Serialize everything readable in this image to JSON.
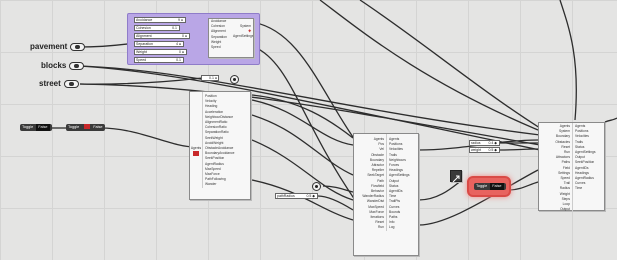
{
  "params": {
    "pavement": "pavement",
    "blocks": "blocks",
    "street": "street"
  },
  "purple_group": {
    "sliders": [
      {
        "name": "Avoidance",
        "value": "9 ●"
      },
      {
        "name": "Cohesion",
        "value": "0.1"
      },
      {
        "name": "Alignment",
        "value": "0 ●"
      },
      {
        "name": "Separation",
        "value": "4 ●"
      },
      {
        "name": "Weight",
        "value": "0 ●"
      },
      {
        "name": "Speed",
        "value": "0.1"
      }
    ],
    "component_inputs": [
      "Avoidance",
      "Cohesion",
      "Alignment",
      "Separation",
      "Weight",
      "Speed"
    ],
    "component_outputs": [
      "System",
      "AgentSettings"
    ]
  },
  "toggles": {
    "left_toggle": {
      "name": "Toggle",
      "state": "False"
    },
    "mid_toggle": {
      "name": "Toggle",
      "state": "False"
    },
    "red_toggle": {
      "name": "Toggle",
      "state": "False"
    }
  },
  "left_component": {
    "input": "Agents",
    "outputs": [
      "Position",
      "Velocity",
      "Heading",
      "Acceleration",
      "NeighbourDistance",
      "AlignmentRatio",
      "CohesionRatio",
      "SeparationRatio",
      "SeekWeight",
      "AvoidWeight",
      "ObstacleAvoidance",
      "BoundaryAvoidance",
      "SeekPosition",
      "AgentRadius",
      "MaxSpeed",
      "MaxForce",
      "PathFollowing",
      "Wander"
    ]
  },
  "mid_component": {
    "inputs": [
      "Agents",
      "Pos",
      "Vel",
      "Obstacle",
      "Boundary",
      "Attractor",
      "Repeller",
      "SeekTarget",
      "Path",
      "Flowfield",
      "Behavior",
      "WanderRadius",
      "WanderDist",
      "MaxSpeed",
      "MaxForce",
      "Iterations",
      "Reset",
      "Run"
    ],
    "outputs": [
      "Agents",
      "Positions",
      "Velocities",
      "Trails",
      "Neighbours",
      "Forces",
      "Headings",
      "AgentSettings",
      "Output",
      "Status",
      "AgentIDs",
      "Time",
      "TrailPts",
      "Curves",
      "Bounds",
      "Paths",
      "Info",
      "Log"
    ]
  },
  "mid_slider": {
    "name": "pathRadius",
    "value": "0.5 ◆"
  },
  "right_sliders": [
    {
      "name": "radius",
      "value": "0.4 ◆"
    },
    {
      "name": "weight",
      "value": "0.5 ◆"
    }
  ],
  "right_component": {
    "inputs": [
      "Agents",
      "System",
      "Boundary",
      "Obstacles",
      "Reset",
      "Run",
      "Attractors",
      "Paths",
      "Field",
      "Settings",
      "Speed",
      "Trail",
      "Radius",
      "Weight",
      "Steps",
      "Loop",
      "Output"
    ],
    "outputs": [
      "Agents",
      "Positions",
      "Velocities",
      "Trails",
      "Status",
      "AgentSettings",
      "Output",
      "SeekPosition",
      "AgentIDs",
      "Headings",
      "AgentRadius",
      "Curves",
      "Time"
    ]
  },
  "colors": {
    "canvas": "#e4e4e3",
    "purple_group": "#b9a6e6",
    "red_group": "#e8635f",
    "wire": "#2a2a2a"
  }
}
